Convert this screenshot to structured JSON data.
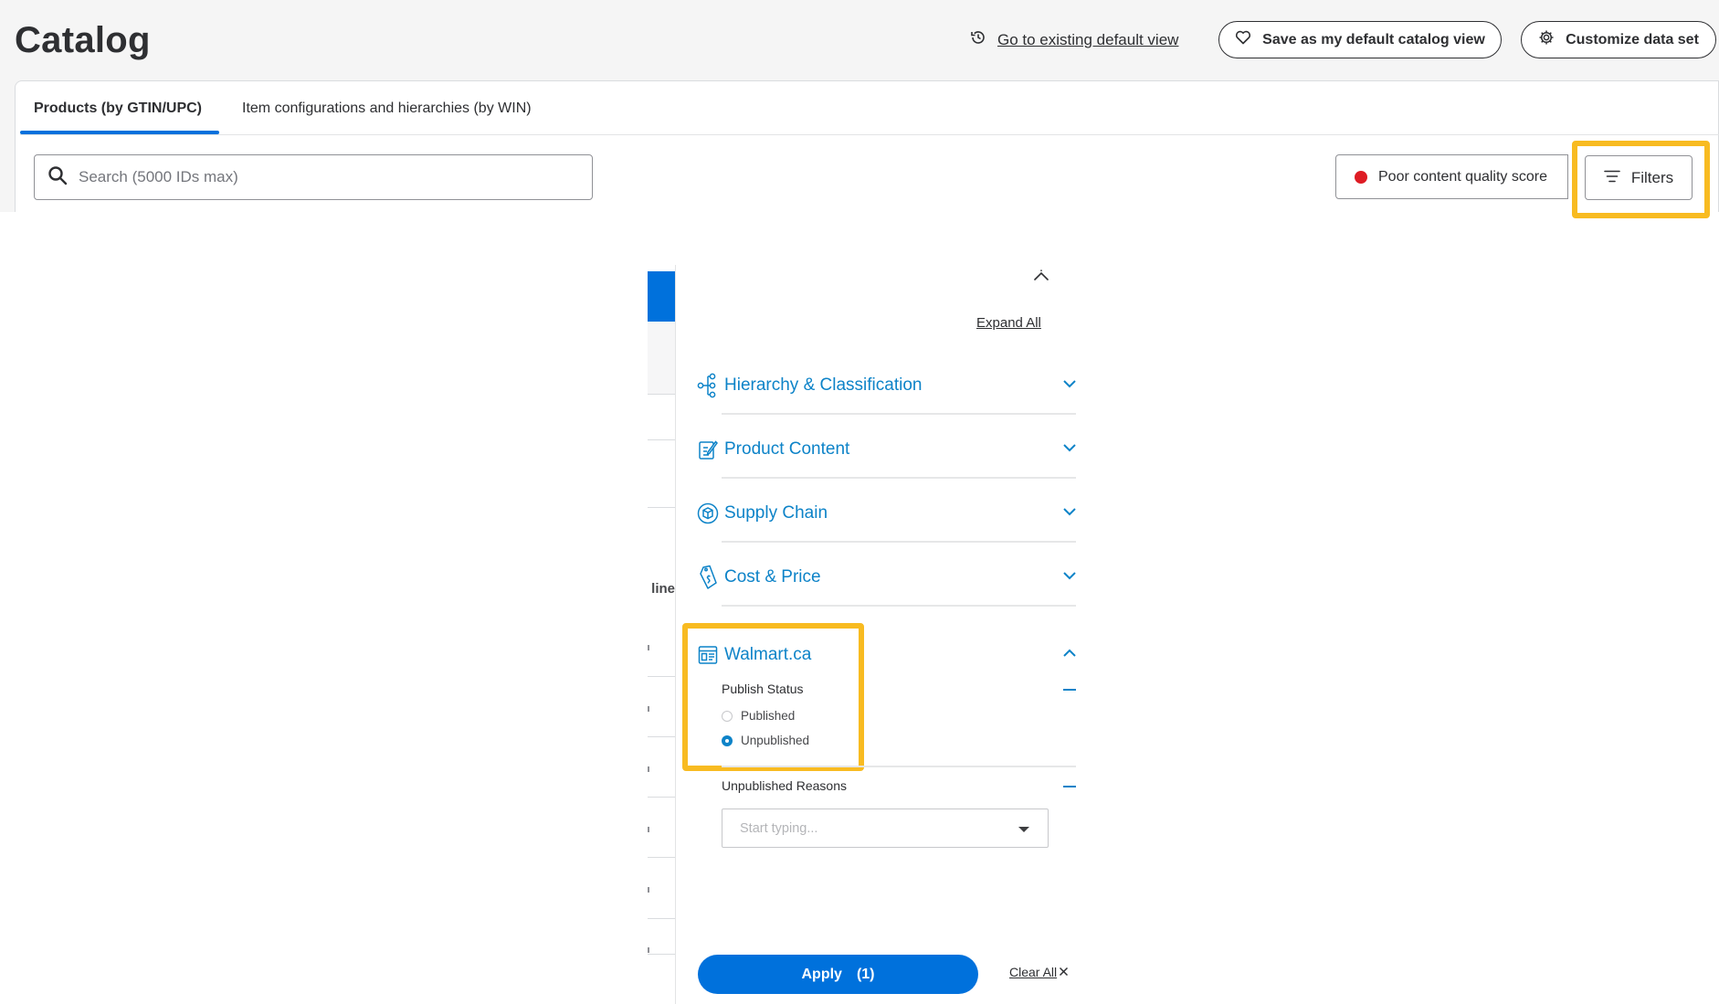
{
  "header": {
    "title": "Catalog",
    "goto_default_link": "Go to existing default view",
    "save_default_button": "Save as my default catalog view",
    "customize_button": "Customize data set"
  },
  "tabs": [
    {
      "label": "Products (by GTIN/UPC)",
      "active": true
    },
    {
      "label": "Item configurations and hierarchies (by WIN)",
      "active": false
    }
  ],
  "search": {
    "placeholder": "Search (5000 IDs max)",
    "value": ""
  },
  "toolbar": {
    "quality_button": "Poor content quality score",
    "filters_button": "Filters"
  },
  "background": {
    "column_fragment": "line"
  },
  "filters": {
    "expand_all": "Expand All",
    "sections": [
      {
        "label": "Hierarchy & Classification",
        "icon": "hierarchy-icon",
        "expanded": false
      },
      {
        "label": "Product Content",
        "icon": "edit-document-icon",
        "expanded": false
      },
      {
        "label": "Supply Chain",
        "icon": "package-icon",
        "expanded": false
      },
      {
        "label": "Cost & Price",
        "icon": "price-tag-icon",
        "expanded": false
      },
      {
        "label": "Walmart.ca",
        "icon": "web-page-icon",
        "expanded": true
      }
    ],
    "publish_status": {
      "label": "Publish Status",
      "options": [
        {
          "label": "Published",
          "selected": false
        },
        {
          "label": "Unpublished",
          "selected": true
        }
      ]
    },
    "unpublished_reasons": {
      "label": "Unpublished Reasons",
      "placeholder": "Start typing..."
    },
    "apply_button": "Apply",
    "apply_count": "(1)",
    "clear_all": "Clear All"
  },
  "colors": {
    "accent": "#0071dc",
    "filter_link": "#0d83c8",
    "highlight": "#f8bb21",
    "status_red": "#de1c24"
  }
}
